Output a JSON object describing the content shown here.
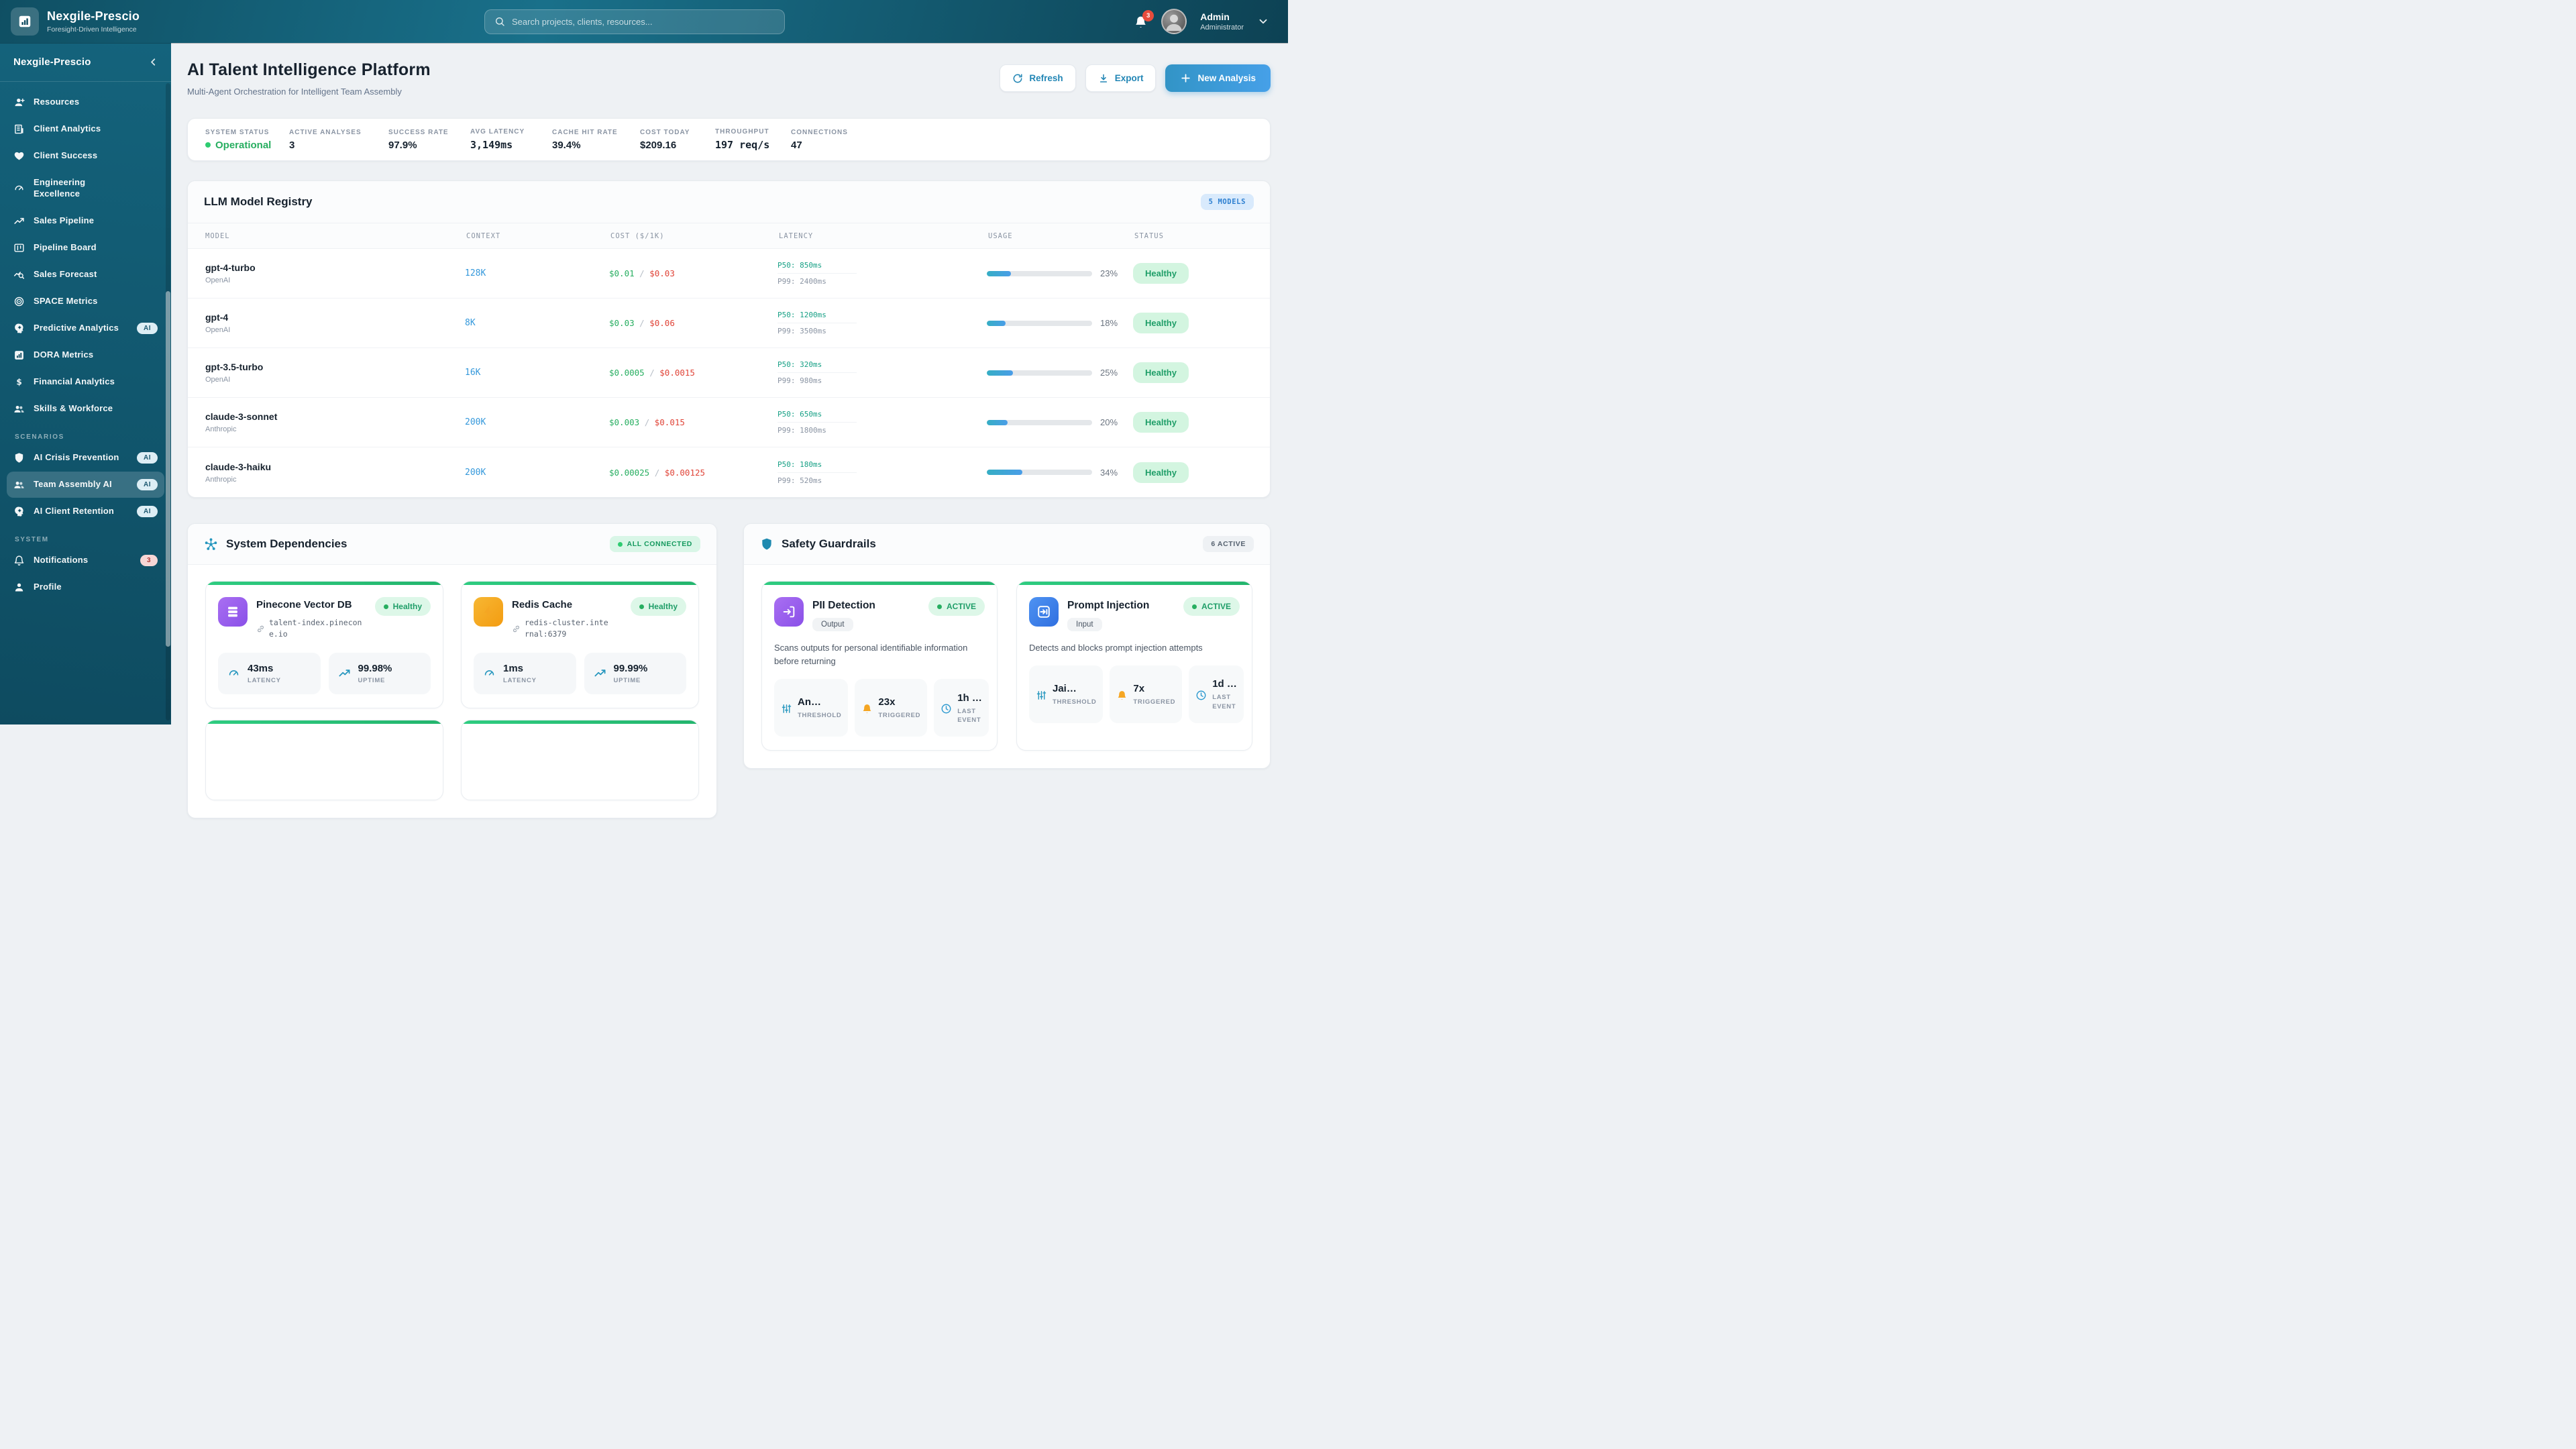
{
  "nav": {
    "brand": "Nexgile-Prescio",
    "tagline": "Foresight-Driven Intelligence",
    "search_placeholder": "Search projects, clients, resources...",
    "notification_count": "3",
    "user_name": "Admin",
    "user_role": "Administrator"
  },
  "sidebar": {
    "title": "Nexgile-Prescio",
    "main_items": [
      {
        "label": "Resources"
      },
      {
        "label": "Client Analytics"
      },
      {
        "label": "Client Success"
      },
      {
        "label": "Engineering Excellence"
      },
      {
        "label": "Sales Pipeline"
      },
      {
        "label": "Pipeline Board"
      },
      {
        "label": "Sales Forecast"
      },
      {
        "label": "SPACE Metrics"
      },
      {
        "label": "Predictive Analytics",
        "badge": "AI"
      },
      {
        "label": "DORA Metrics"
      },
      {
        "label": "Financial Analytics"
      },
      {
        "label": "Skills & Workforce"
      }
    ],
    "scenarios_header": "SCENARIOS",
    "scenario_items": [
      {
        "label": "AI Crisis Prevention",
        "badge": "AI"
      },
      {
        "label": "Team Assembly AI",
        "badge": "AI"
      },
      {
        "label": "AI Client Retention",
        "badge": "AI"
      }
    ],
    "system_header": "SYSTEM",
    "system_items": [
      {
        "label": "Notifications",
        "badge": "3"
      },
      {
        "label": "Profile"
      }
    ]
  },
  "page": {
    "title": "AI Talent Intelligence Platform",
    "subtitle": "Multi-Agent Orchestration for Intelligent Team Assembly",
    "refresh_label": "Refresh",
    "export_label": "Export",
    "new_analysis_label": "New Analysis"
  },
  "status_bar": {
    "metrics": [
      {
        "label": "SYSTEM STATUS",
        "value": "Operational"
      },
      {
        "label": "ACTIVE ANALYSES",
        "value": "3"
      },
      {
        "label": "SUCCESS RATE",
        "value": "97.9%"
      },
      {
        "label": "AVG LATENCY",
        "value": "3,149ms"
      },
      {
        "label": "CACHE HIT RATE",
        "value": "39.4%"
      },
      {
        "label": "COST TODAY",
        "value": "$209.16"
      },
      {
        "label": "THROUGHPUT",
        "value": "197 req/s"
      },
      {
        "label": "CONNECTIONS",
        "value": "47"
      }
    ]
  },
  "registry": {
    "title": "LLM Model Registry",
    "count_badge": "5 MODELS",
    "columns": [
      "MODEL",
      "CONTEXT",
      "COST ($/1K)",
      "LATENCY",
      "USAGE",
      "STATUS"
    ],
    "models": [
      {
        "name": "gpt-4-turbo",
        "provider": "OpenAI",
        "context": "128K",
        "cost_in": "$0.01",
        "cost_sep": "/",
        "cost_out": "$0.03",
        "p50": "P50: 850ms",
        "p99": "P99: 2400ms",
        "usage_pct": "23%",
        "status": "Healthy"
      },
      {
        "name": "gpt-4",
        "provider": "OpenAI",
        "context": "8K",
        "cost_in": "$0.03",
        "cost_sep": "/",
        "cost_out": "$0.06",
        "p50": "P50: 1200ms",
        "p99": "P99: 3500ms",
        "usage_pct": "18%",
        "status": "Healthy"
      },
      {
        "name": "gpt-3.5-turbo",
        "provider": "OpenAI",
        "context": "16K",
        "cost_in": "$0.0005",
        "cost_sep": "/",
        "cost_out": "$0.0015",
        "p50": "P50: 320ms",
        "p99": "P99: 980ms",
        "usage_pct": "25%",
        "status": "Healthy"
      },
      {
        "name": "claude-3-sonnet",
        "provider": "Anthropic",
        "context": "200K",
        "cost_in": "$0.003",
        "cost_sep": "/",
        "cost_out": "$0.015",
        "p50": "P50: 650ms",
        "p99": "P99: 1800ms",
        "usage_pct": "20%",
        "status": "Healthy"
      },
      {
        "name": "claude-3-haiku",
        "provider": "Anthropic",
        "context": "200K",
        "cost_in": "$0.00025",
        "cost_sep": "/",
        "cost_out": "$0.00125",
        "p50": "P50: 180ms",
        "p99": "P99: 520ms",
        "usage_pct": "34%",
        "status": "Healthy"
      }
    ]
  },
  "dependencies": {
    "title": "System Dependencies",
    "status_badge": "ALL CONNECTED",
    "metric_labels": {
      "latency": "LATENCY",
      "uptime": "UPTIME"
    },
    "items": [
      {
        "name": "Pinecone Vector DB",
        "status": "Healthy",
        "endpoint": "talent-index.pinecone.io",
        "latency": "43ms",
        "uptime": "99.98%"
      },
      {
        "name": "Redis Cache",
        "status": "Healthy",
        "endpoint": "redis-cluster.internal:6379",
        "latency": "1ms",
        "uptime": "99.99%"
      }
    ]
  },
  "guardrails": {
    "title": "Safety Guardrails",
    "count_badge": "6 ACTIVE",
    "status_label": "ACTIVE",
    "metric_labels": {
      "threshold": "THRESHOLD",
      "triggered": "TRIGGERED",
      "last_event": "LAST EVENT"
    },
    "items": [
      {
        "name": "PII Detection",
        "tag": "Output",
        "description": "Scans outputs for personal identifiable information before returning",
        "threshold": "An…",
        "triggered": "23x",
        "last_event": "1h …"
      },
      {
        "name": "Prompt Injection",
        "tag": "Input",
        "description": "Detects and blocks prompt injection attempts",
        "threshold": "Jai…",
        "triggered": "7x",
        "last_event": "1d …"
      }
    ]
  }
}
